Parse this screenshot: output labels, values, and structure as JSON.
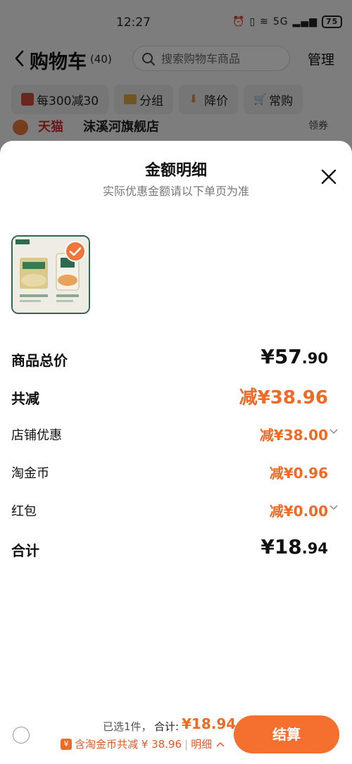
{
  "status_bar": {
    "time": "12:27",
    "network": "5G",
    "battery": "75"
  },
  "nav": {
    "title": "购物车",
    "count": "(40)",
    "search_placeholder": "搜索购物车商品",
    "manage": "管理"
  },
  "chips": [
    {
      "icon": "gift-icon",
      "label": "每300减30"
    },
    {
      "icon": "folder-icon",
      "label": "分组"
    },
    {
      "icon": "price-down-icon",
      "label": "降价"
    },
    {
      "icon": "cart-icon",
      "label": "常购"
    }
  ],
  "store": {
    "tag": "天猫",
    "name": "沫溪河旗舰店",
    "coupon": "领券"
  },
  "sheet": {
    "title": "金额明细",
    "subtitle": "实际优惠金额请以下单页为准",
    "rows": [
      {
        "label": "商品总价",
        "value_main": "¥57",
        "value_cents": ".90"
      },
      {
        "label": "共减",
        "value": "减¥38.96"
      },
      {
        "label": "店铺优惠",
        "value": "减¥38.00"
      },
      {
        "label": "淘金币",
        "value": "减¥0.96"
      },
      {
        "label": "红包",
        "value": "减¥0.00"
      },
      {
        "label": "合计",
        "value_main": "¥18",
        "value_cents": ".94"
      }
    ]
  },
  "checkout": {
    "selected": "已选1件，",
    "total_label": "合计:",
    "total_value": "¥18.94",
    "discount_text": "含淘金币共减 ¥ 38.96",
    "separator": "|",
    "detail_label": "明细",
    "button_label": "结算"
  },
  "colors": {
    "accent": "#f06a26",
    "check": "#f0763a",
    "store_red": "#c9332b"
  }
}
